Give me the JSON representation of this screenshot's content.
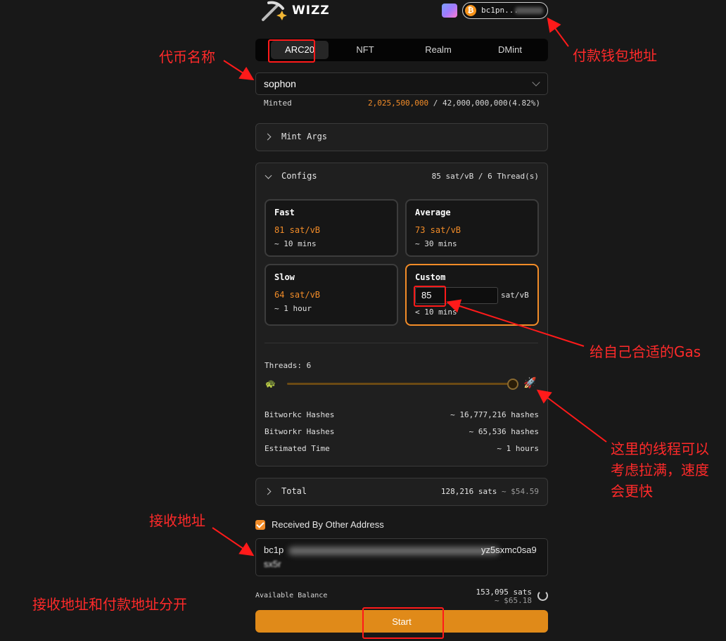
{
  "header": {
    "logo_text": "WIZZ",
    "wallet_address": "bc1pn...",
    "btc_symbol": "₿"
  },
  "tabs": [
    {
      "label": "ARC20",
      "active": true
    },
    {
      "label": "NFT",
      "active": false
    },
    {
      "label": "Realm",
      "active": false
    },
    {
      "label": "DMint",
      "active": false
    }
  ],
  "token_select": {
    "value": "sophon"
  },
  "minted": {
    "label": "Minted",
    "minted_amount": "2,025,500,000",
    "rest": " / 42,000,000,000(4.82%)"
  },
  "mint_args": {
    "label": "Mint Args"
  },
  "configs": {
    "label": "Configs",
    "summary": "85 sat/vB / 6 Thread(s)",
    "fee_options": [
      {
        "title": "Fast",
        "rate": "81 sat/vB",
        "time": "~ 10 mins"
      },
      {
        "title": "Average",
        "rate": "73 sat/vB",
        "time": "~ 30 mins"
      },
      {
        "title": "Slow",
        "rate": "64 sat/vB",
        "time": "~ 1 hour"
      }
    ],
    "custom": {
      "title": "Custom",
      "value": "85",
      "unit": "sat/vB",
      "time": "< 10 mins"
    },
    "threads_label": "Threads: 6",
    "threads_value": 6,
    "threads_level": 1.0,
    "stats": [
      {
        "label": "Bitworkc Hashes",
        "value": "~ 16,777,216 hashes"
      },
      {
        "label": "Bitworkr Hashes",
        "value": "~ 65,536 hashes"
      },
      {
        "label": "Estimated Time",
        "value": "~ 1 hours"
      }
    ]
  },
  "total": {
    "label": "Total",
    "sats": "128,216 sats",
    "usd": "~ $54.59"
  },
  "receive": {
    "checkbox_label": "Received By Other Address",
    "checked": true,
    "address_visible_start": "bc1p",
    "address_visible_end": "yz5sxmc0sa9",
    "address_line2": "sx5r"
  },
  "balance": {
    "label": "Available Balance",
    "sats": "153,095 sats",
    "usd": "~ $65.18"
  },
  "start_button": {
    "label": "Start"
  },
  "annotations": {
    "token_name": "代币名称",
    "payment_wallet": "付款钱包地址",
    "gas": "给自己合适的Gas",
    "threads": "这里的线程可以\n考虑拉满，速度\n会更快",
    "receive_address": "接收地址",
    "separate": "接收地址和付款地址分开"
  },
  "colors": {
    "accent": "#f28c28",
    "annotation": "#ff2a2a",
    "start_button": "#e08a19"
  }
}
